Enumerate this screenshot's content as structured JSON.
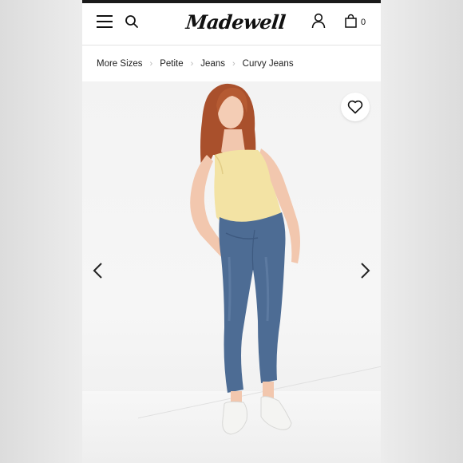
{
  "header": {
    "logo_text": "Madewell",
    "bag_count": "0",
    "icons": [
      "menu-icon",
      "search-icon",
      "account-icon",
      "bag-icon"
    ]
  },
  "breadcrumb": {
    "items": [
      "More Sizes",
      "Petite",
      "Jeans",
      "Curvy Jeans"
    ]
  },
  "product_image": {
    "icons": [
      "heart-icon",
      "chevron-left-icon",
      "chevron-right-icon"
    ],
    "colors": {
      "top": "#f3e3a4",
      "denim": "#4d6c94",
      "hair": "#b1552f",
      "sneakers": "#f4f4f2"
    }
  }
}
